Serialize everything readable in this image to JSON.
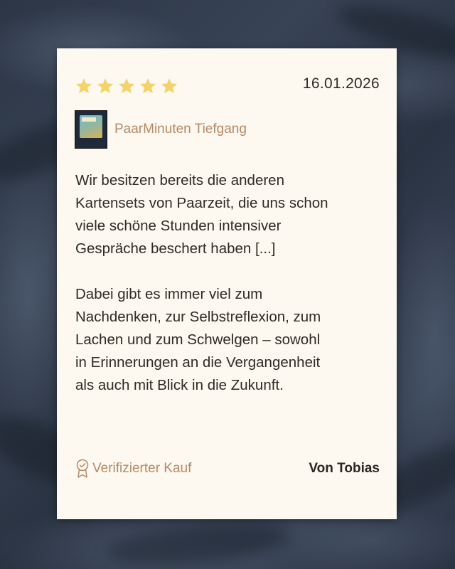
{
  "review": {
    "rating": 5,
    "rating_max": 5,
    "star_color": "#f3d36b",
    "date": "16.01.2026",
    "product": {
      "name": "PaarMinuten Tiefgang",
      "thumbnail_icon": "product-card-deck-image"
    },
    "paragraphs": [
      "Wir besitzen bereits die anderen\nKartensets von Paarzeit, die uns schon\nviele schöne Stunden intensiver\nGespräche beschert haben [...]",
      "Dabei gibt es immer viel zum\nNachdenken, zur  Selbstreflexion, zum\nLachen und zum Schwelgen – sowohl\nin Erinnerungen  an die Vergangenheit\nals auch mit Blick in die Zukunft."
    ],
    "verified_label": "Verifizierter Kauf",
    "verified_icon": "award-badge-icon",
    "author": "Von Tobias"
  },
  "colors": {
    "card_background": "#fdf9f0",
    "accent_text": "#b48a66",
    "body_text": "#2f2a26",
    "backdrop": "#2c3646"
  }
}
